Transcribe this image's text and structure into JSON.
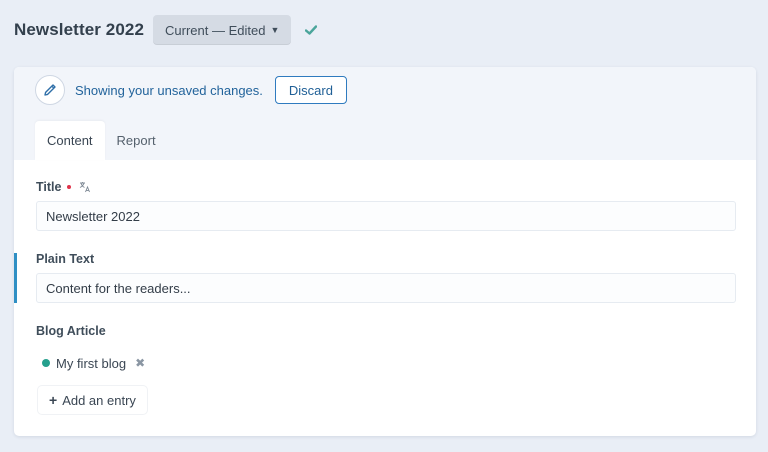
{
  "header": {
    "title": "Newsletter 2022",
    "revision_label": "Current — Edited",
    "chevron_icon": "chevron-down-icon",
    "status_icon": "check-icon",
    "status_color": "#4aa59b"
  },
  "notice": {
    "icon": "pencil-icon",
    "text": "Showing your unsaved changes.",
    "discard_label": "Discard",
    "accent_color": "#2f7bbf"
  },
  "tabs": [
    {
      "label": "Content",
      "active": true
    },
    {
      "label": "Report",
      "active": false
    }
  ],
  "fields": {
    "title": {
      "label": "Title",
      "required": true,
      "translatable": true,
      "value": "Newsletter 2022"
    },
    "plain_text": {
      "label": "Plain Text",
      "value": "Content for the readers..."
    },
    "blog_article": {
      "label": "Blog Article",
      "entries": [
        {
          "label": "My first blog",
          "status_color": "#25a08d",
          "remove_icon": "close-icon"
        }
      ],
      "add_label": "Add an entry",
      "add_icon": "plus-icon"
    }
  }
}
